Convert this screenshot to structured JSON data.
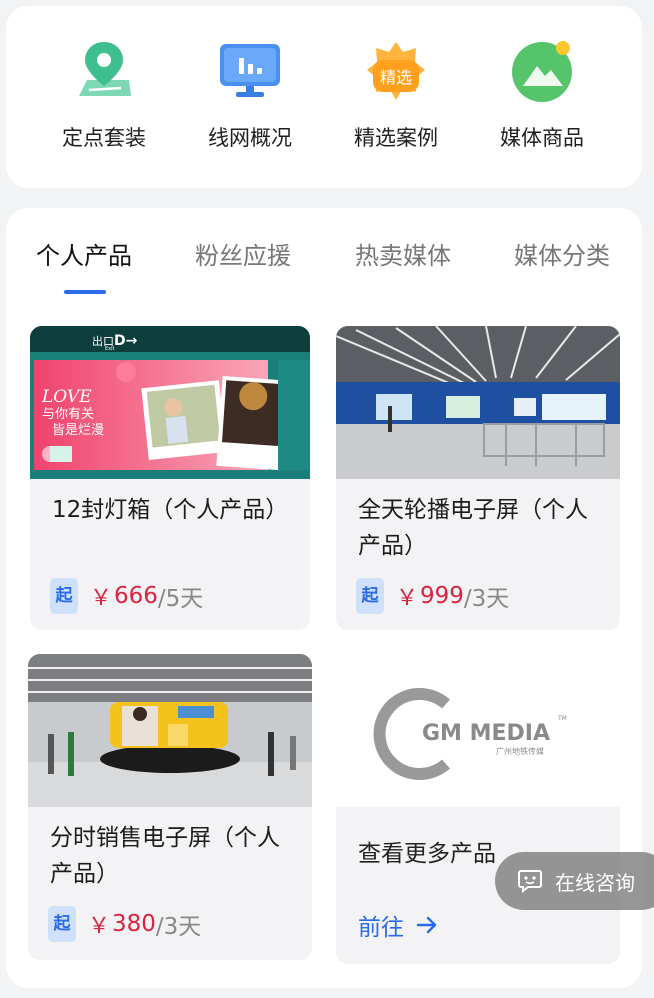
{
  "quick_nav": [
    {
      "label": "定点套装",
      "icon": "map-pin-icon"
    },
    {
      "label": "线网概况",
      "icon": "monitor-chart-icon"
    },
    {
      "label": "精选案例",
      "icon": "star-badge-icon",
      "icon_text": "精选"
    },
    {
      "label": "媒体商品",
      "icon": "landscape-icon"
    }
  ],
  "tabs": [
    "个人产品",
    "粉丝应援",
    "热卖媒体",
    "媒体分类"
  ],
  "products": [
    {
      "title": "12封灯箱（个人产品）",
      "badge": "起",
      "currency": "￥",
      "amount": "666",
      "unit": "/5天"
    },
    {
      "title": "全天轮播电子屏（个人产品）",
      "badge": "起",
      "currency": "￥",
      "amount": "999",
      "unit": "/3天"
    },
    {
      "title": "分时销售电子屏（个人产品）",
      "badge": "起",
      "currency": "￥",
      "amount": "380",
      "unit": "/3天"
    }
  ],
  "ad_images": {
    "exit_sign": "出口",
    "exit_sub": "Exit",
    "love": "LOVE",
    "line1": "与你有关",
    "line2": "皆是烂漫"
  },
  "more": {
    "logo_text": "GM MEDIA",
    "logo_tm": "TM",
    "logo_sub": "广州地铁传媒",
    "title": "查看更多产品",
    "goto": "前往"
  },
  "consult": "在线咨询",
  "colors": {
    "accent": "#2b6bea",
    "price": "#d9233f"
  }
}
